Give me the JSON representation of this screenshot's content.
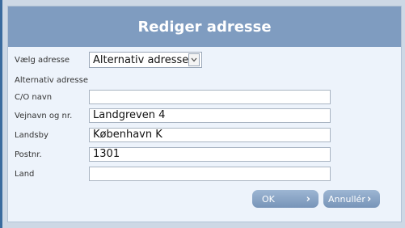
{
  "dialog": {
    "title": "Rediger adresse",
    "select_label": "Vælg adresse",
    "select_value": "Alternativ adresse",
    "section_label": "Alternativ adresse",
    "fields": [
      {
        "label": "C/O navn",
        "value": ""
      },
      {
        "label": "Vejnavn og nr.",
        "value": "Landgreven 4"
      },
      {
        "label": "Landsby",
        "value": "København K"
      },
      {
        "label": "Postnr.",
        "value": "1301"
      },
      {
        "label": "Land",
        "value": ""
      }
    ],
    "ok_label": "OK",
    "cancel_label": "Annullér"
  },
  "colors": {
    "titlebar": "#7f9cc0",
    "panel": "#edf3fb",
    "button": "#8aa5c7"
  }
}
